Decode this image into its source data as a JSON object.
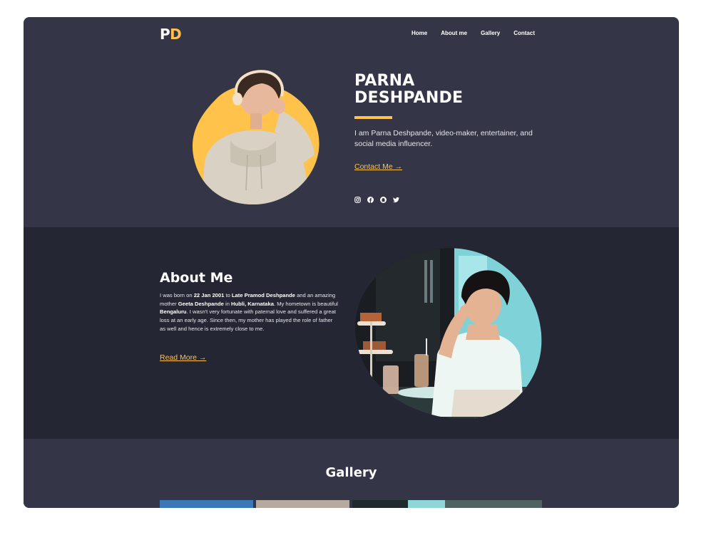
{
  "nav": {
    "logo_first": "P",
    "logo_second": "D",
    "links": [
      "Home",
      "About me",
      "Gallery",
      "Contact"
    ]
  },
  "hero": {
    "name_line1": "PARNA",
    "name_line2": "DESHPANDE",
    "description": "I am Parna Deshpande, video-maker, entertainer, and social media influencer.",
    "cta": "Contact Me →",
    "socials": [
      "instagram-icon",
      "facebook-icon",
      "snapchat-icon",
      "twitter-icon"
    ]
  },
  "about": {
    "title": "About Me",
    "text": {
      "p1": "I was born on ",
      "b1": "22 Jan 2001",
      "p2": " to ",
      "b2": "Late Pramod Deshpande",
      "p3": " and an amazing mother ",
      "b3": "Geeta Deshpande",
      "p4": " in ",
      "b4": "Hubli, Karnataka",
      "p5": ". My hometown is beautiful ",
      "b5": "Bengaluru",
      "p6": ". I wasn't very fortunate with paternal love and suffered a great loss at an early age. Since then, my mother has played the role of father as well and hence is extremely close to me."
    },
    "cta": "Read More →"
  },
  "gallery": {
    "title": "Gallery"
  },
  "colors": {
    "accent": "#ffc24a",
    "hero_bg": "#343547",
    "about_bg": "#252633",
    "text": "#ffffff"
  }
}
